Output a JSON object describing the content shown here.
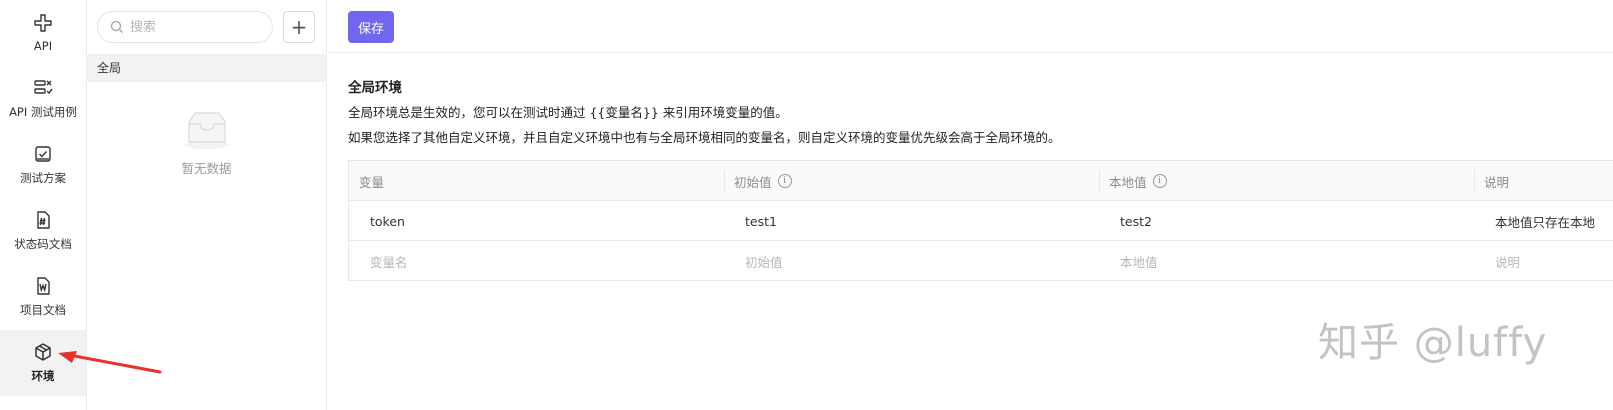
{
  "nav": {
    "items": [
      {
        "label": "API",
        "icon": "api-icon"
      },
      {
        "label": "API 测试用例",
        "icon": "test-case-icon"
      },
      {
        "label": "测试方案",
        "icon": "test-plan-icon"
      },
      {
        "label": "状态码文档",
        "icon": "status-code-doc-icon"
      },
      {
        "label": "项目文档",
        "icon": "project-doc-icon"
      },
      {
        "label": "环境",
        "icon": "environment-icon",
        "active": true
      }
    ]
  },
  "env_panel": {
    "search_placeholder": "搜索",
    "add_label": "+",
    "group_label": "全局",
    "empty_text": "暂无数据"
  },
  "main": {
    "save_label": "保存",
    "title": "全局环境",
    "desc1": "全局环境总是生效的，您可以在测试时通过 {{变量名}} 来引用环境变量的值。",
    "desc2": "如果您选择了其他自定义环境，并且自定义环境中也有与全局环境相同的变量名，则自定义环境的变量优先级会高于全局环境的。"
  },
  "table": {
    "headers": [
      "变量",
      "初始值",
      "本地值",
      "说明"
    ],
    "rows": [
      [
        "token",
        "test1",
        "test2",
        "本地值只存在本地"
      ]
    ],
    "placeholders": [
      "变量名",
      "初始值",
      "本地值",
      "说明"
    ]
  },
  "watermark": "知乎 @luffy",
  "colors": {
    "accent": "#7067ee",
    "arrow": "#e8312a",
    "active_nav_bg": "#f2f2f2"
  }
}
